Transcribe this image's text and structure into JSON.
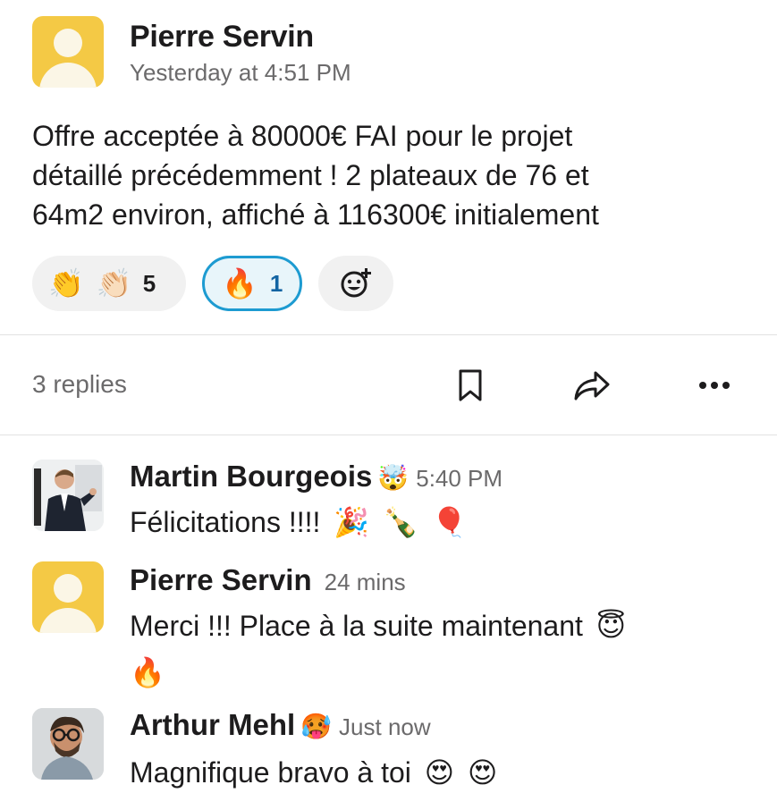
{
  "message": {
    "author": "Pierre Servin",
    "timestamp": "Yesterday at 4:51 PM",
    "text_lines": [
      "Offre acceptée à 80000€ FAI pour le projet",
      "détaillé précédemment ! 2 plateaux de 76 et",
      "64m2 environ, affiché à 116300€ initialement"
    ],
    "reactions": [
      {
        "emojis": [
          "👏",
          "👏🏻"
        ],
        "count": "5",
        "selected": false
      },
      {
        "emojis": [
          "🔥"
        ],
        "count": "1",
        "selected": true
      }
    ],
    "add_reaction_icon": "add-emoji-icon"
  },
  "thread_bar": {
    "replies_label": "3 replies",
    "icons": [
      "bookmark-icon",
      "share-icon",
      "more-icon"
    ]
  },
  "replies": [
    {
      "author": "Martin Bourgeois",
      "status_emoji": "🤯",
      "time": "5:40 PM",
      "text": "Félicitations !!!!",
      "emojis": [
        "🎉",
        "🍾",
        "🎈"
      ]
    },
    {
      "author": "Pierre Servin",
      "status_emoji": "",
      "time": "24 mins",
      "text": "Merci !!! Place à la suite maintenant",
      "emojis": [
        "😇"
      ],
      "second_line_emoji": "🔥"
    },
    {
      "author": "Arthur Mehl",
      "status_emoji": "🥵",
      "time": "Just now",
      "text": "Magnifique bravo à toi",
      "emojis": [
        "😍",
        "😍"
      ]
    }
  ],
  "colors": {
    "accent_blue": "#1d9bd1",
    "avatar_yellow": "#f4c945",
    "muted_text": "#6b6a6b"
  }
}
